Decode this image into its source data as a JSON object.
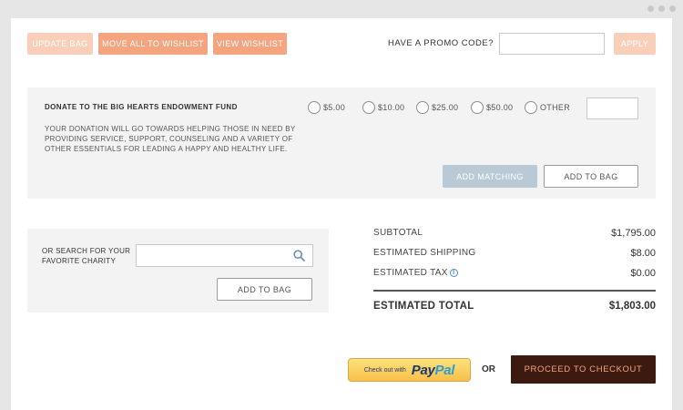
{
  "toolbar": {
    "update_bag": "Update Bag",
    "move_all_to_wishlist": "Move all to Wishlist",
    "view_wishlist": "View Wishlist"
  },
  "promo": {
    "label": "Have a promo code?",
    "value": "",
    "apply": "Apply"
  },
  "donation": {
    "title": "Donate to the Big Hearts Endowment Fund",
    "description": "Your donation will go towards helping those in need by providing service, support, counseling and a variety of other essentials for leading a happy and healthy life.",
    "options": [
      "$5.00",
      "$10.00",
      "$25.00",
      "$50.00",
      "Other"
    ],
    "other_value": "",
    "add_matching": "Add Matching",
    "add_to_bag": "Add to Bag"
  },
  "charity_search": {
    "label": "Or search for your favorite charity",
    "value": "",
    "add_to_bag": "Add to Bag"
  },
  "summary": {
    "subtotal_label": "Subtotal",
    "subtotal_value": "$1,795.00",
    "shipping_label": "Estimated Shipping",
    "shipping_value": "$8.00",
    "tax_label": "Estimated Tax",
    "tax_value": "$0.00",
    "total_label": "Estimated Total",
    "total_value": "$1,803.00"
  },
  "checkout": {
    "paypal_small": "Check out with",
    "paypal_pay": "Pay",
    "paypal_pal": "Pal",
    "or": "OR",
    "proceed": "Proceed to Checkout"
  },
  "colors": {
    "accent": "#f4a47f",
    "checkout_bg": "#3c1a10",
    "matching_bg": "#b9c9d6"
  }
}
